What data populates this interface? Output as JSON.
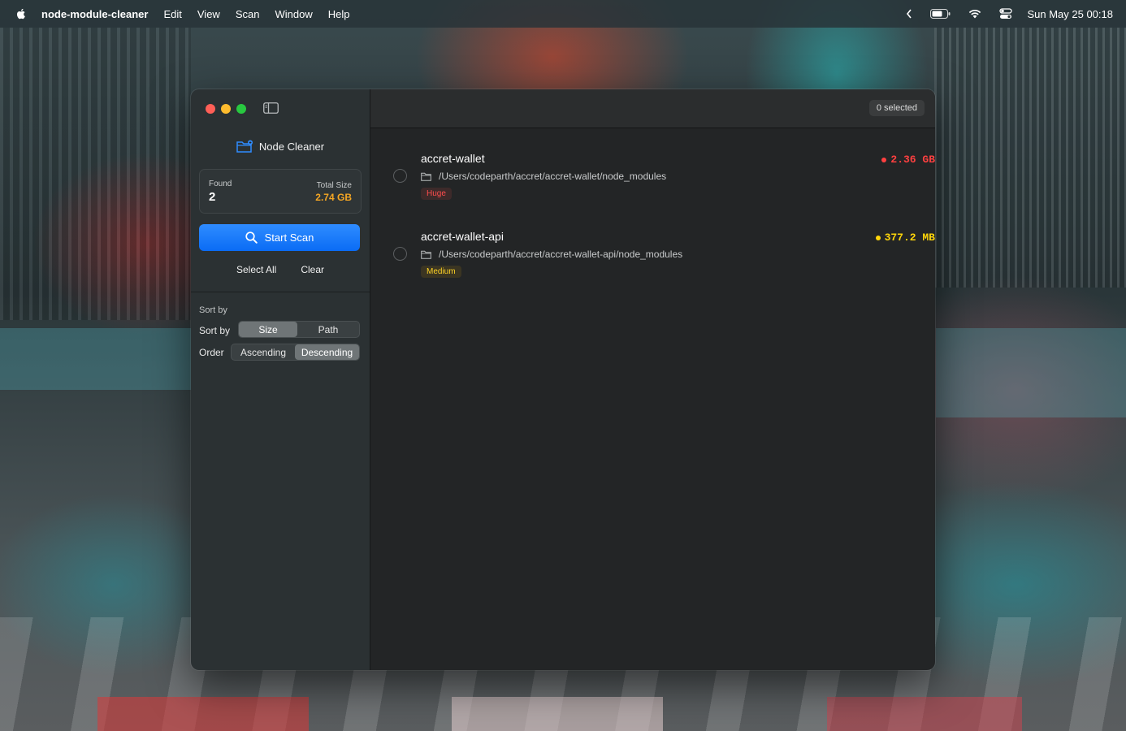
{
  "menubar": {
    "app_name": "node-module-cleaner",
    "menus": [
      "Edit",
      "View",
      "Scan",
      "Window",
      "Help"
    ],
    "clock": "Sun May 25  00:18",
    "icons": [
      "apple-icon",
      "chevron-left-icon",
      "battery-icon",
      "wifi-icon",
      "control-center-icon"
    ]
  },
  "sidebar": {
    "brand": "Node Cleaner",
    "stats": {
      "found_label": "Found",
      "found_value": "2",
      "size_label": "Total Size",
      "size_value": "2.74 GB"
    },
    "scan_button": "Start Scan",
    "select_all": "Select All",
    "clear": "Clear",
    "sort_heading": "Sort by",
    "sort_label": "Sort by",
    "sort_options": [
      "Size",
      "Path"
    ],
    "sort_selected": "Size",
    "order_label": "Order",
    "order_options": [
      "Ascending",
      "Descending"
    ],
    "order_selected": "Descending"
  },
  "toolbar": {
    "selected": "0 selected"
  },
  "results": [
    {
      "name": "accret-wallet",
      "path": "/Users/codeparth/accret/accret-wallet/node_modules",
      "badge": "Huge",
      "size": "2.36 GB",
      "color": "#ff4040"
    },
    {
      "name": "accret-wallet-api",
      "path": "/Users/codeparth/accret/accret-wallet-api/node_modules",
      "badge": "Medium",
      "size": "377.2 MB",
      "color": "#ffd60a"
    }
  ],
  "colors": {
    "accent": "#0a6cf5",
    "total_size": "#f5a623",
    "huge": "#ff4040",
    "medium": "#ffd60a"
  }
}
